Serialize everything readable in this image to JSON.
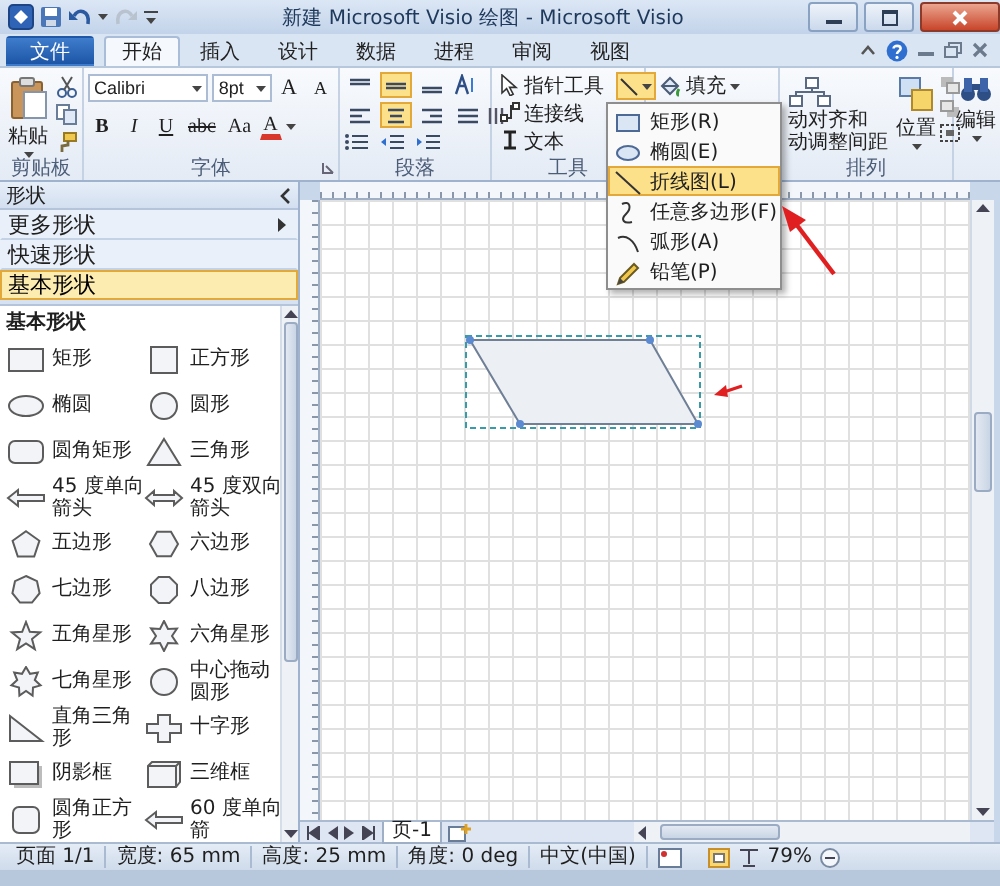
{
  "window": {
    "title": "新建 Microsoft Visio 绘图 - Microsoft Visio"
  },
  "tabs": [
    {
      "label": "文件",
      "kind": "file",
      "selected": false
    },
    {
      "label": "开始",
      "kind": "tab",
      "selected": true
    },
    {
      "label": "插入",
      "kind": "tab",
      "selected": false
    },
    {
      "label": "设计",
      "kind": "tab",
      "selected": false
    },
    {
      "label": "数据",
      "kind": "tab",
      "selected": false
    },
    {
      "label": "进程",
      "kind": "tab",
      "selected": false
    },
    {
      "label": "审阅",
      "kind": "tab",
      "selected": false
    },
    {
      "label": "视图",
      "kind": "tab",
      "selected": false
    }
  ],
  "ribbon": {
    "clipboard": {
      "label": "剪贴板",
      "paste": "粘贴"
    },
    "font": {
      "label": "字体",
      "family": "Calibri",
      "size": "8pt",
      "size_buttons": [
        "A",
        "A"
      ],
      "format_buttons": [
        {
          "label": "B",
          "kind": "bold"
        },
        {
          "label": "I",
          "kind": "italic"
        },
        {
          "label": "U",
          "kind": "underline"
        },
        {
          "label": "abc",
          "kind": "strike"
        },
        {
          "label": "Aa",
          "kind": "case"
        }
      ],
      "color_button": "A"
    },
    "paragraph": {
      "label": "段落",
      "vertical_align": [
        {
          "selected": false
        },
        {
          "selected": true
        },
        {
          "selected": false
        }
      ],
      "horizontal_align": [
        {
          "selected": false
        },
        {
          "selected": true
        },
        {
          "selected": false
        },
        {
          "selected": false
        }
      ]
    },
    "tools": {
      "label": "工具",
      "items": [
        {
          "label": "指针工具",
          "kind": "pointer"
        },
        {
          "label": "连接线",
          "kind": "connector"
        },
        {
          "label": "文本",
          "kind": "text"
        }
      ],
      "shape_button": {
        "expanded": true
      }
    },
    "shape_style": {
      "fill": "填充"
    },
    "arrange": {
      "label": "排列",
      "auto_align_lines": [
        "动对齐和",
        "动调整间距"
      ],
      "position": "位置"
    },
    "editing": {
      "label": "编辑"
    }
  },
  "shape_menu": {
    "items": [
      {
        "label": "矩形(R)",
        "kind": "rectangle",
        "selected": false
      },
      {
        "label": "椭圆(E)",
        "kind": "ellipse",
        "selected": false
      },
      {
        "label": "折线图(L)",
        "kind": "line",
        "selected": true
      },
      {
        "label": "任意多边形(F)",
        "kind": "freeform",
        "selected": false
      },
      {
        "label": "弧形(A)",
        "kind": "arc",
        "selected": false
      },
      {
        "label": "铅笔(P)",
        "kind": "pencil",
        "selected": false
      }
    ]
  },
  "shapes_panel": {
    "title": "形状",
    "sections": [
      {
        "label": "更多形状",
        "kind": "submenu",
        "selected": false
      },
      {
        "label": "快速形状",
        "kind": "stencil",
        "selected": false
      },
      {
        "label": "基本形状",
        "kind": "stencil",
        "selected": true
      }
    ],
    "stencil": {
      "title": "基本形状",
      "shapes": [
        {
          "label": "矩形",
          "kind": "rect"
        },
        {
          "label": "正方形",
          "kind": "square"
        },
        {
          "label": "椭圆",
          "kind": "ellipse"
        },
        {
          "label": "圆形",
          "kind": "circle"
        },
        {
          "label": "圆角矩形",
          "kind": "rounded_rect"
        },
        {
          "label": "三角形",
          "kind": "triangle"
        },
        {
          "label": "45 度单向箭头",
          "kind": "arrow_left"
        },
        {
          "label": "45 度双向箭头",
          "kind": "arrow_double"
        },
        {
          "label": "五边形",
          "kind": "pentagon"
        },
        {
          "label": "六边形",
          "kind": "hexagon"
        },
        {
          "label": "七边形",
          "kind": "heptagon"
        },
        {
          "label": "八边形",
          "kind": "octagon"
        },
        {
          "label": "五角星形",
          "kind": "star5"
        },
        {
          "label": "六角星形",
          "kind": "star6"
        },
        {
          "label": "七角星形",
          "kind": "star7"
        },
        {
          "label": "中心拖动圆形",
          "kind": "circle"
        },
        {
          "label": "直角三角形",
          "kind": "right_triangle"
        },
        {
          "label": "十字形",
          "kind": "cross"
        },
        {
          "label": "阴影框",
          "kind": "shadow_box"
        },
        {
          "label": "三维框",
          "kind": "box_3d"
        },
        {
          "label": "圆角正方形",
          "kind": "rounded_square"
        },
        {
          "label": "60 度单向箭",
          "kind": "arrow_left"
        }
      ]
    }
  },
  "canvas": {
    "shapes": [
      {
        "kind": "parallelogram",
        "selected": true
      }
    ]
  },
  "page_tabs": [
    {
      "label": "页-1",
      "selected": true
    }
  ],
  "status_bar": {
    "items": [
      "页面 1/1",
      "宽度: 65 mm",
      "高度: 25 mm",
      "角度: 0 deg",
      "中文(中国)"
    ],
    "zoom": "79%"
  }
}
